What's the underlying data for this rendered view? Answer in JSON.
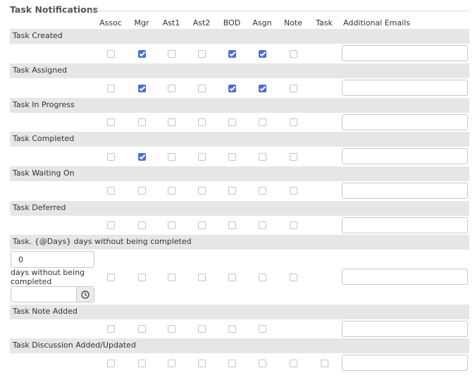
{
  "legend": "Task Notifications",
  "columns": [
    "Assoc",
    "Mgr",
    "Ast1",
    "Ast2",
    "BOD",
    "Asgn",
    "Note",
    "Task",
    "Additional Emails"
  ],
  "rows": [
    {
      "label": "Task Created",
      "checked": [
        false,
        true,
        false,
        false,
        true,
        true,
        false,
        null
      ],
      "email": ""
    },
    {
      "label": "Task Assigned",
      "checked": [
        false,
        true,
        false,
        false,
        true,
        true,
        false,
        null
      ],
      "email": ""
    },
    {
      "label": "Task In Progress",
      "checked": [
        false,
        false,
        false,
        false,
        false,
        false,
        false,
        null
      ],
      "email": ""
    },
    {
      "label": "Task Completed",
      "checked": [
        false,
        true,
        false,
        false,
        false,
        false,
        false,
        null
      ],
      "email": ""
    },
    {
      "label": "Task Waiting On",
      "checked": [
        false,
        false,
        false,
        false,
        false,
        false,
        false,
        null
      ],
      "email": ""
    },
    {
      "label": "Task Deferred",
      "checked": [
        false,
        false,
        false,
        false,
        false,
        false,
        false,
        null
      ],
      "email": ""
    },
    {
      "label": "Task. {@Days} days without being completed",
      "checked": [
        false,
        false,
        false,
        false,
        false,
        false,
        false,
        null
      ],
      "email": ""
    },
    {
      "label": "Task Note Added",
      "checked": [
        false,
        false,
        false,
        false,
        false,
        false,
        null,
        null
      ],
      "email": ""
    },
    {
      "label": "Task Discussion Added/Updated",
      "checked": [
        false,
        false,
        false,
        false,
        false,
        false,
        false,
        false
      ],
      "email": ""
    }
  ],
  "days_field": {
    "value": "0",
    "label": "days without being completed"
  },
  "time_field": {
    "value": "",
    "icon": "clock-icon"
  },
  "colors": {
    "band": "#e6e6e6",
    "checked": "#4a6fdc"
  }
}
